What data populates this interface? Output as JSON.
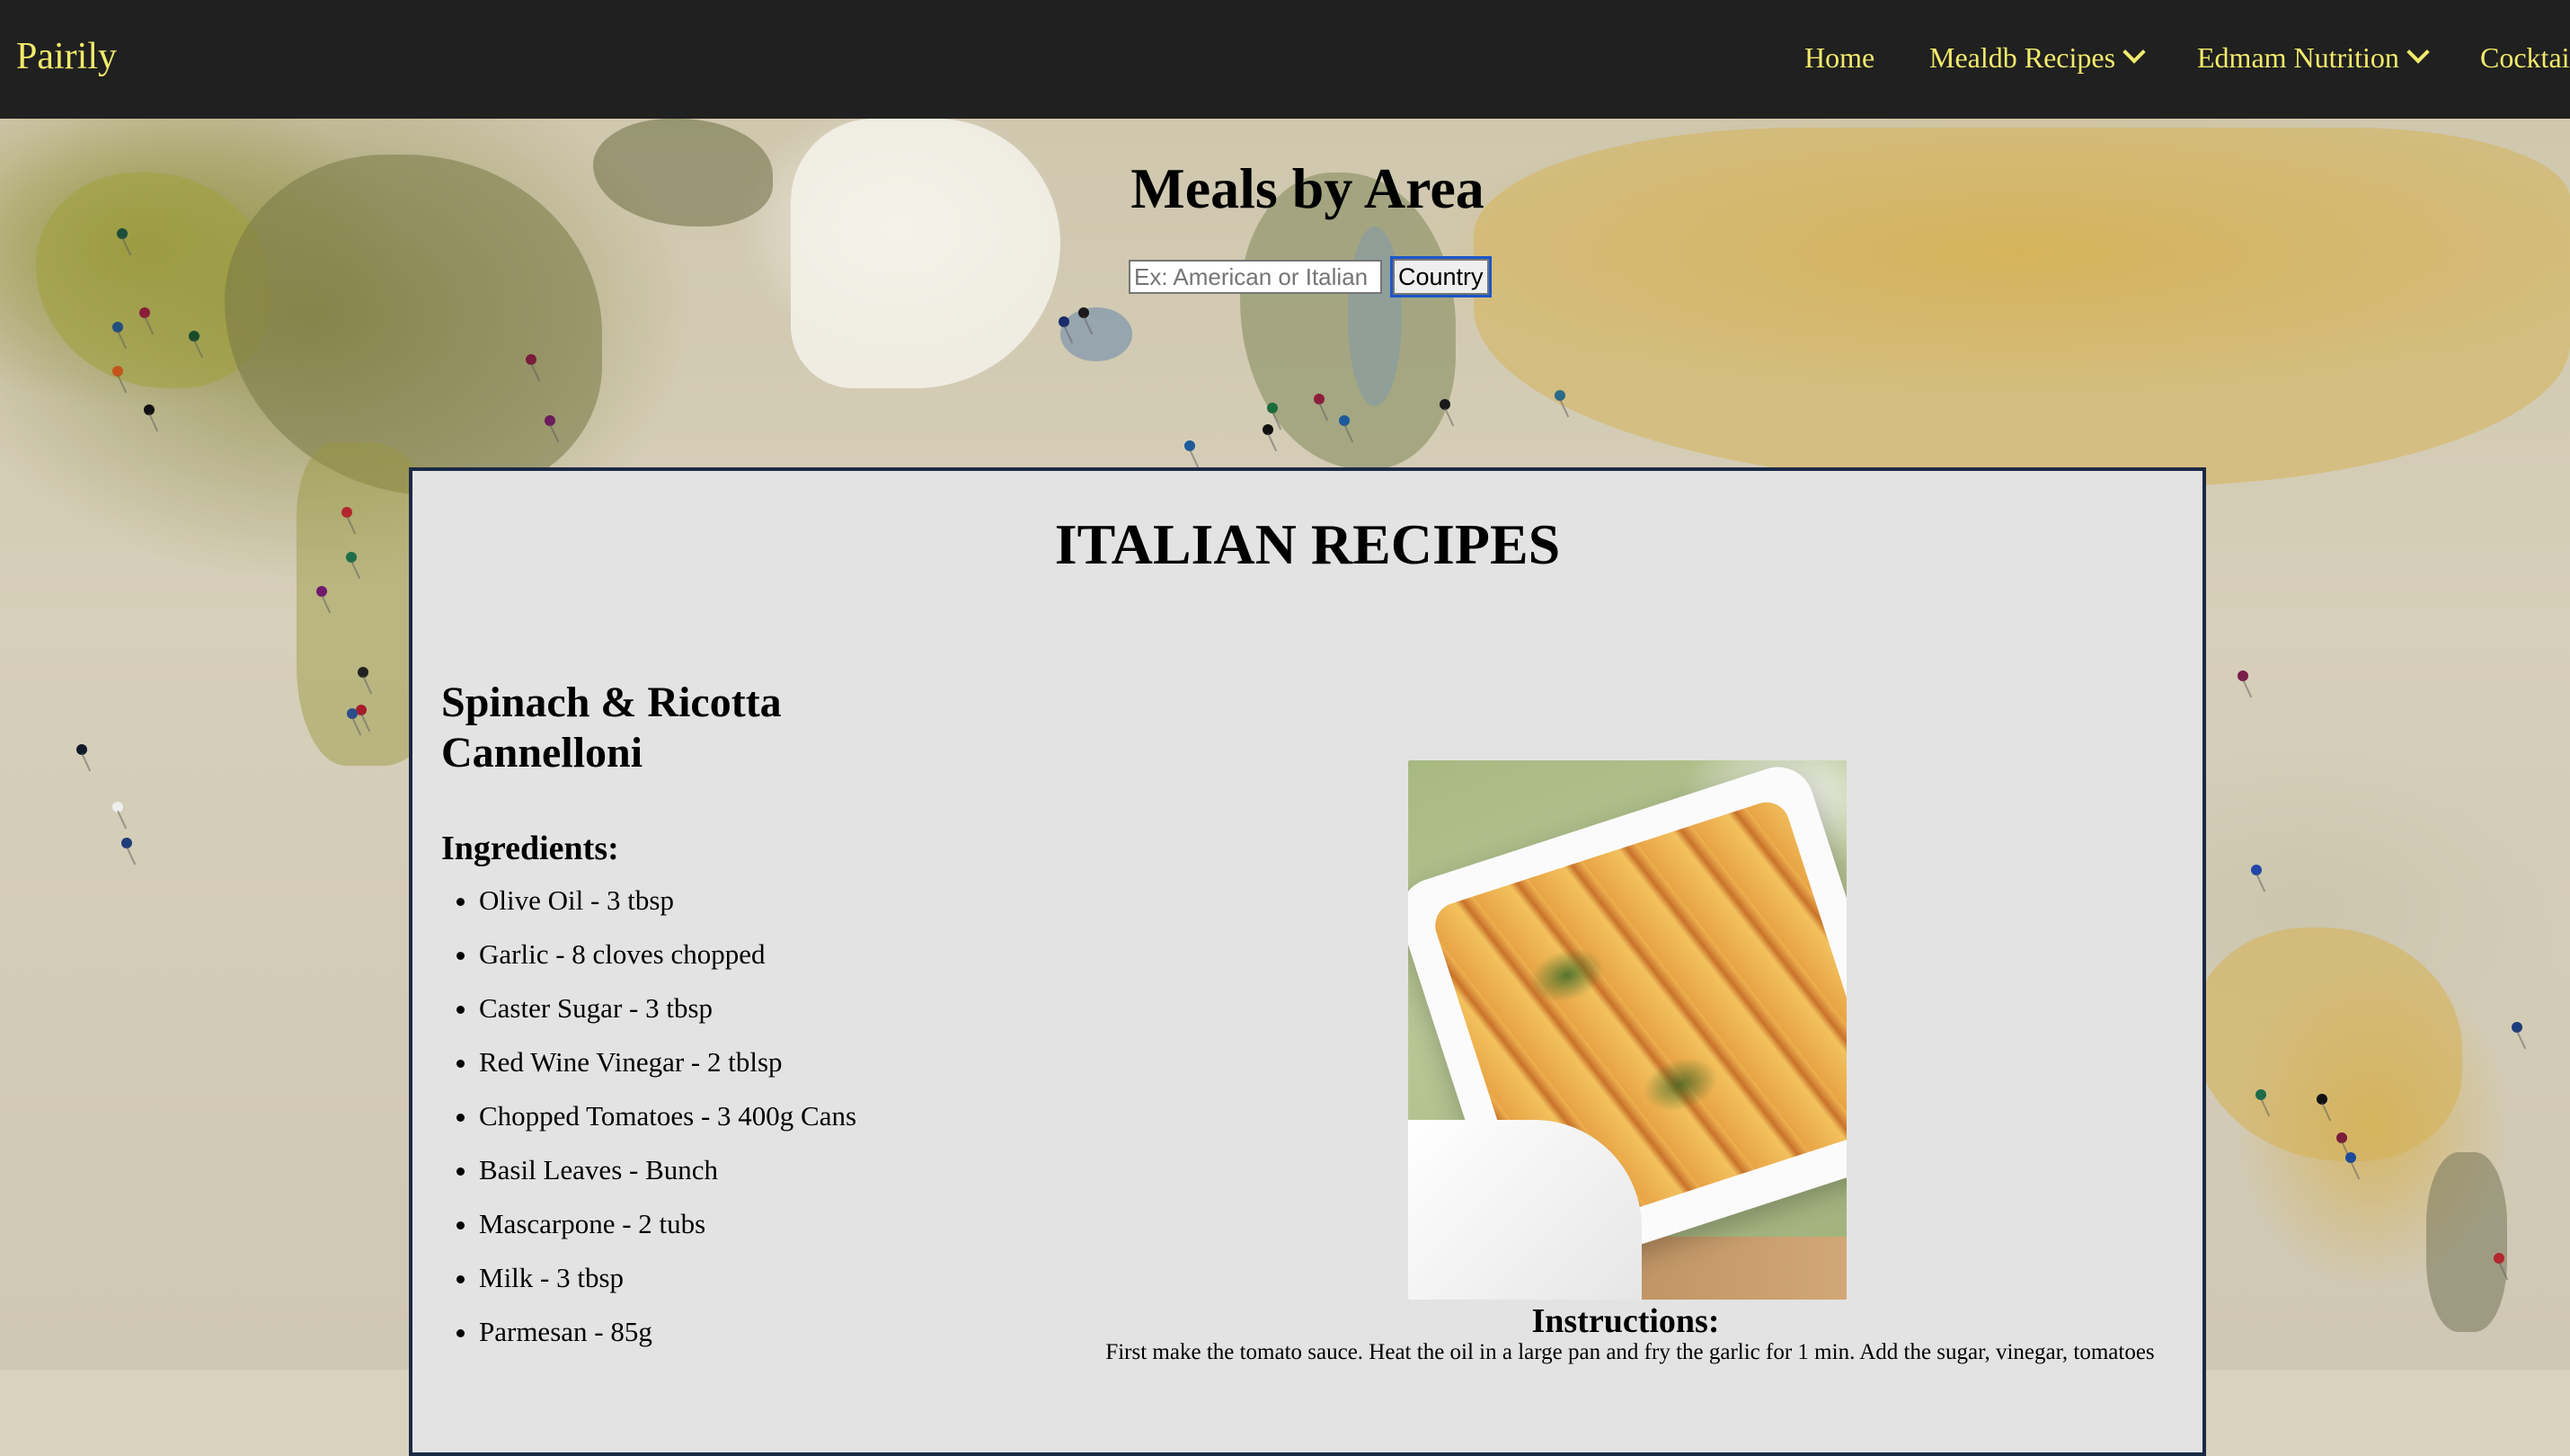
{
  "navbar": {
    "brand": "Pairily",
    "items": [
      {
        "label": "Home",
        "has_dropdown": false
      },
      {
        "label": "Mealdb Recipes",
        "has_dropdown": true
      },
      {
        "label": "Edmam Nutrition",
        "has_dropdown": true
      },
      {
        "label": "Cocktai",
        "has_dropdown": false
      }
    ],
    "accent_color": "#f2ea6b",
    "background_color": "#202020"
  },
  "header": {
    "title": "Meals by Area",
    "search_placeholder": "Ex: American or Italian",
    "search_value": "",
    "search_button_label": "Country"
  },
  "results": {
    "section_title": "ITALIAN RECIPES",
    "meal": {
      "name": "Spinach & Ricotta Cannelloni",
      "ingredients_heading": "Ingredients:",
      "ingredients": [
        "Olive Oil - 3 tbsp",
        "Garlic - 8 cloves chopped",
        "Caster Sugar - 3 tbsp",
        "Red Wine Vinegar - 2 tblsp",
        "Chopped Tomatoes - 3 400g Cans",
        "Basil Leaves - Bunch",
        "Mascarpone - 2 tubs",
        "Milk - 3 tbsp",
        "Parmesan - 85g"
      ],
      "image_icon": "meal-photo-cannelloni",
      "instructions_heading": "Instructions:",
      "instructions": "First make the tomato sauce. Heat the oil in a large pan and fry the garlic for 1 min. Add the sugar, vinegar, tomatoes"
    }
  }
}
